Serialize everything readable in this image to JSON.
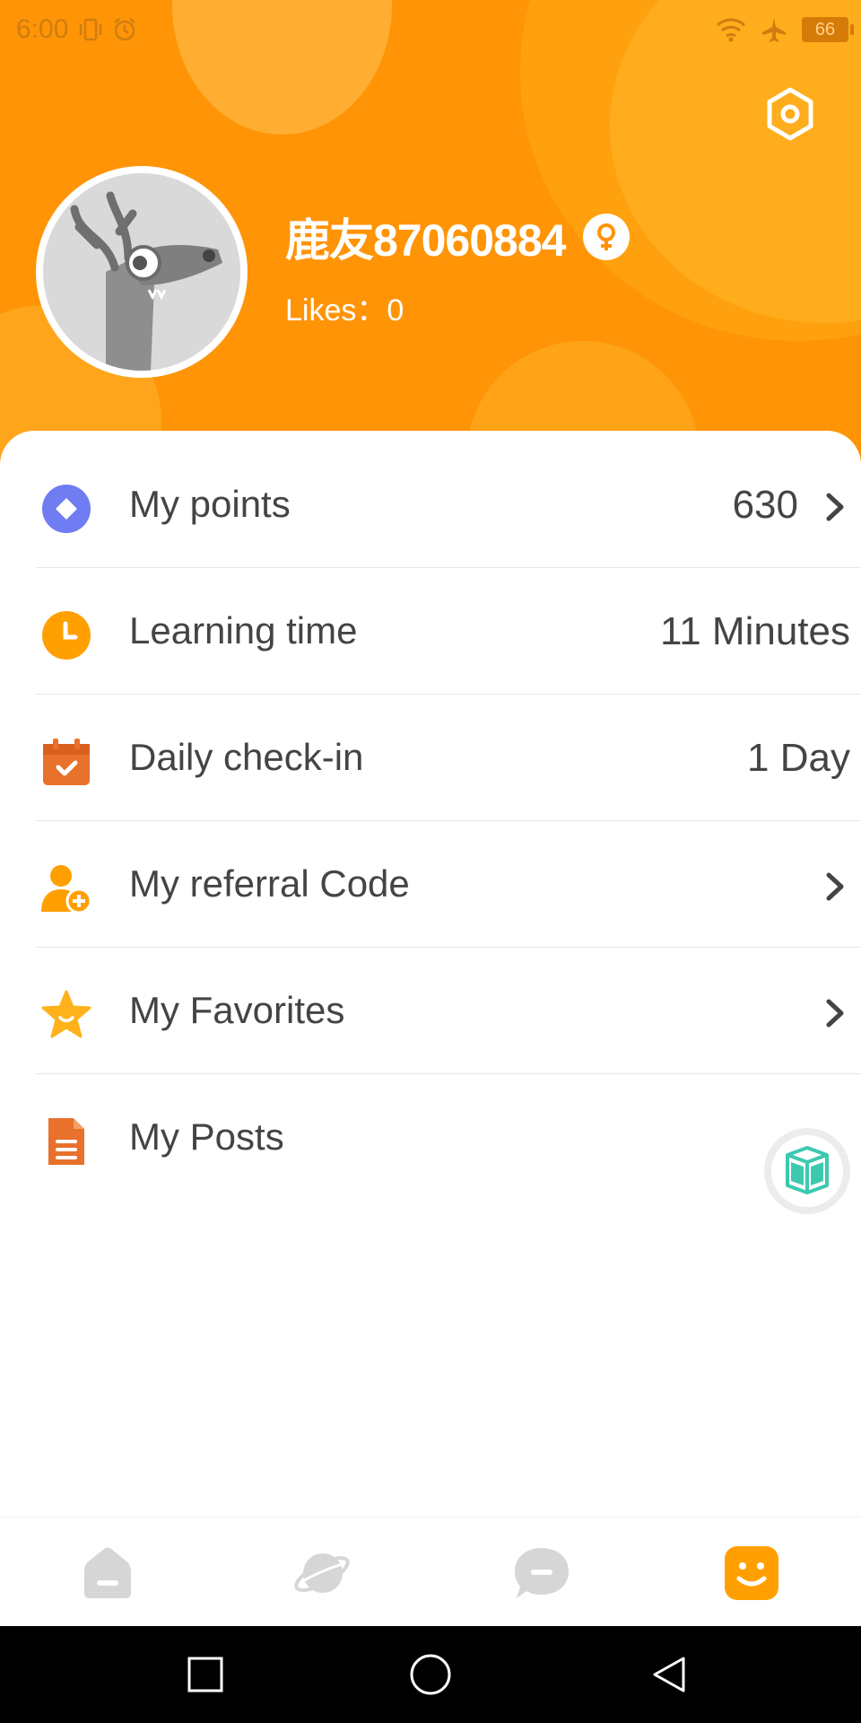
{
  "status_bar": {
    "time": "6:00",
    "battery_level": "66",
    "icons": [
      "vibrate-icon",
      "alarm-icon",
      "wifi-icon",
      "airplane-icon",
      "battery-icon"
    ]
  },
  "header": {
    "username": "鹿友87060884",
    "likes_text": "Likes：0",
    "gender": "female",
    "settings_icon": "settings-hex-icon",
    "background_color": "#ff9407"
  },
  "menu": [
    {
      "id": "points",
      "icon": "points-diamond-icon",
      "label": "My points",
      "value": "630",
      "has_chevron": true
    },
    {
      "id": "learning-time",
      "icon": "clock-icon",
      "label": "Learning time",
      "value": "11 Minutes",
      "has_chevron": false
    },
    {
      "id": "daily-checkin",
      "icon": "calendar-check-icon",
      "label": "Daily check-in",
      "value": "1 Day",
      "has_chevron": false
    },
    {
      "id": "referral-code",
      "icon": "add-user-icon",
      "label": "My referral Code",
      "value": "",
      "has_chevron": true
    },
    {
      "id": "favorites",
      "icon": "star-icon",
      "label": "My Favorites",
      "value": "",
      "has_chevron": true
    },
    {
      "id": "posts",
      "icon": "document-icon",
      "label": "My Posts",
      "value": "",
      "has_chevron": false
    }
  ],
  "bottom_nav": [
    {
      "id": "home",
      "icon": "home-icon",
      "active": false
    },
    {
      "id": "discover",
      "icon": "planet-icon",
      "active": false
    },
    {
      "id": "messages",
      "icon": "chat-icon",
      "active": false
    },
    {
      "id": "profile",
      "icon": "smile-face-icon",
      "active": true
    }
  ],
  "system_nav": [
    "recent-apps-icon",
    "home-circle-icon",
    "back-triangle-icon"
  ],
  "colors": {
    "accent_orange": "#ff9407",
    "points_blue": "#6f7cf2",
    "text_dark": "#444444",
    "nav_inactive": "#d6d6d6",
    "fab_teal": "#3cc9b0"
  }
}
